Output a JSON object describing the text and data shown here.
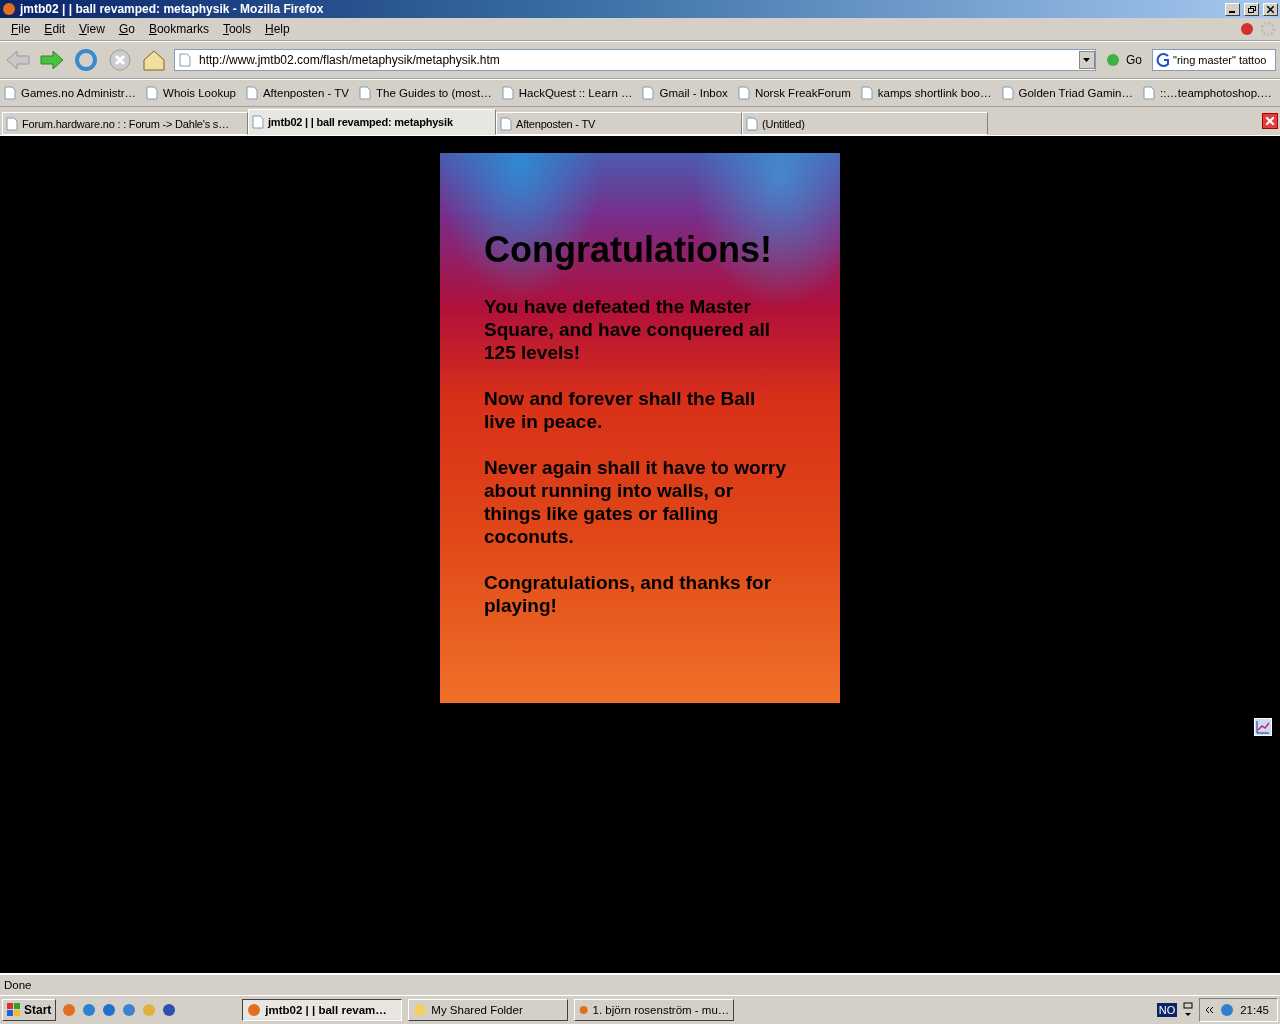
{
  "window": {
    "title": "jmtb02 | | ball revamped: metaphysik - Mozilla Firefox"
  },
  "menu": [
    "File",
    "Edit",
    "View",
    "Go",
    "Bookmarks",
    "Tools",
    "Help"
  ],
  "toolbar": {
    "url": "http://www.jmtb02.com/flash/metaphysik/metaphysik.htm",
    "go_label": "Go",
    "search": "\"ring master\" tattoo"
  },
  "bookmarks": [
    {
      "label": "Games.no Administr…"
    },
    {
      "label": "Whois Lookup"
    },
    {
      "label": "Aftenposten - TV"
    },
    {
      "label": "The Guides to (most…"
    },
    {
      "label": "HackQuest :: Learn …"
    },
    {
      "label": "Gmail - Inbox"
    },
    {
      "label": "Norsk FreakForum"
    },
    {
      "label": "kamps shortlink boo…"
    },
    {
      "label": "Golden Triad Gamin…"
    },
    {
      "label": "::…teamphotoshop.…"
    }
  ],
  "tabs": [
    {
      "label": "Forum.hardware.no : : Forum -> Dahle's s…",
      "selected": false
    },
    {
      "label": "jmtb02 | | ball revamped: metaphysik",
      "selected": true
    },
    {
      "label": "Aftenposten - TV",
      "selected": false
    },
    {
      "label": "(Untitled)",
      "selected": false
    }
  ],
  "content": {
    "heading": "Congratulations!",
    "paragraphs": [
      "You have defeated the Master Square, and have conquered all 125 levels!",
      "Now and forever shall the Ball live in peace.",
      "Never again shall it have to worry about running into walls, or things like gates or falling coconuts.",
      "Congratulations, and thanks for playing!"
    ]
  },
  "status_bar": "Done",
  "taskbar": {
    "start": "Start",
    "tasks": [
      {
        "label": "jmtb02 | | ball revam…",
        "selected": true
      },
      {
        "label": "My Shared Folder",
        "selected": false
      },
      {
        "label": "1. björn rosenström - mu…",
        "selected": false
      }
    ],
    "language": "NO",
    "clock": "21:45"
  }
}
